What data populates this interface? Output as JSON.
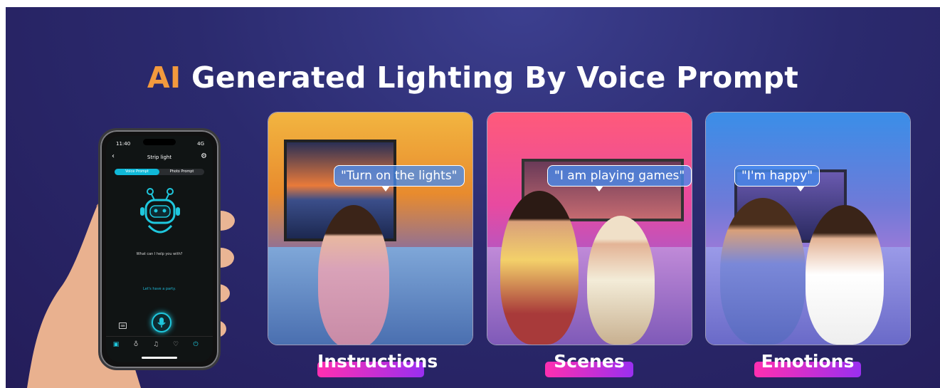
{
  "banner": {
    "title_highlight": "AI",
    "title_rest": "Generated Lighting By Voice Prompt"
  },
  "phone": {
    "status_time": "11:40",
    "status_signal": "4G",
    "nav_title": "Strip light",
    "tabs": [
      "Voice Prompt",
      "Photo Prompt"
    ],
    "question": "What can I help you with?",
    "suggestion": "Let's have a party.",
    "tab_icons": [
      "calendar-icon",
      "bulb-icon",
      "music-icon",
      "heart-icon",
      "power-icon"
    ]
  },
  "cards": [
    {
      "bubble": "\"Turn on the lights\"",
      "label": "Instructions"
    },
    {
      "bubble": "\"I am playing games\"",
      "label": "Scenes"
    },
    {
      "bubble": "\"I'm happy\"",
      "label": "Emotions"
    }
  ],
  "colors": {
    "accent_orange": "#f39a3d",
    "label_gradient_start": "#ff2fb0",
    "label_gradient_end": "#9a2ff0",
    "app_cyan": "#1fc7dd"
  }
}
